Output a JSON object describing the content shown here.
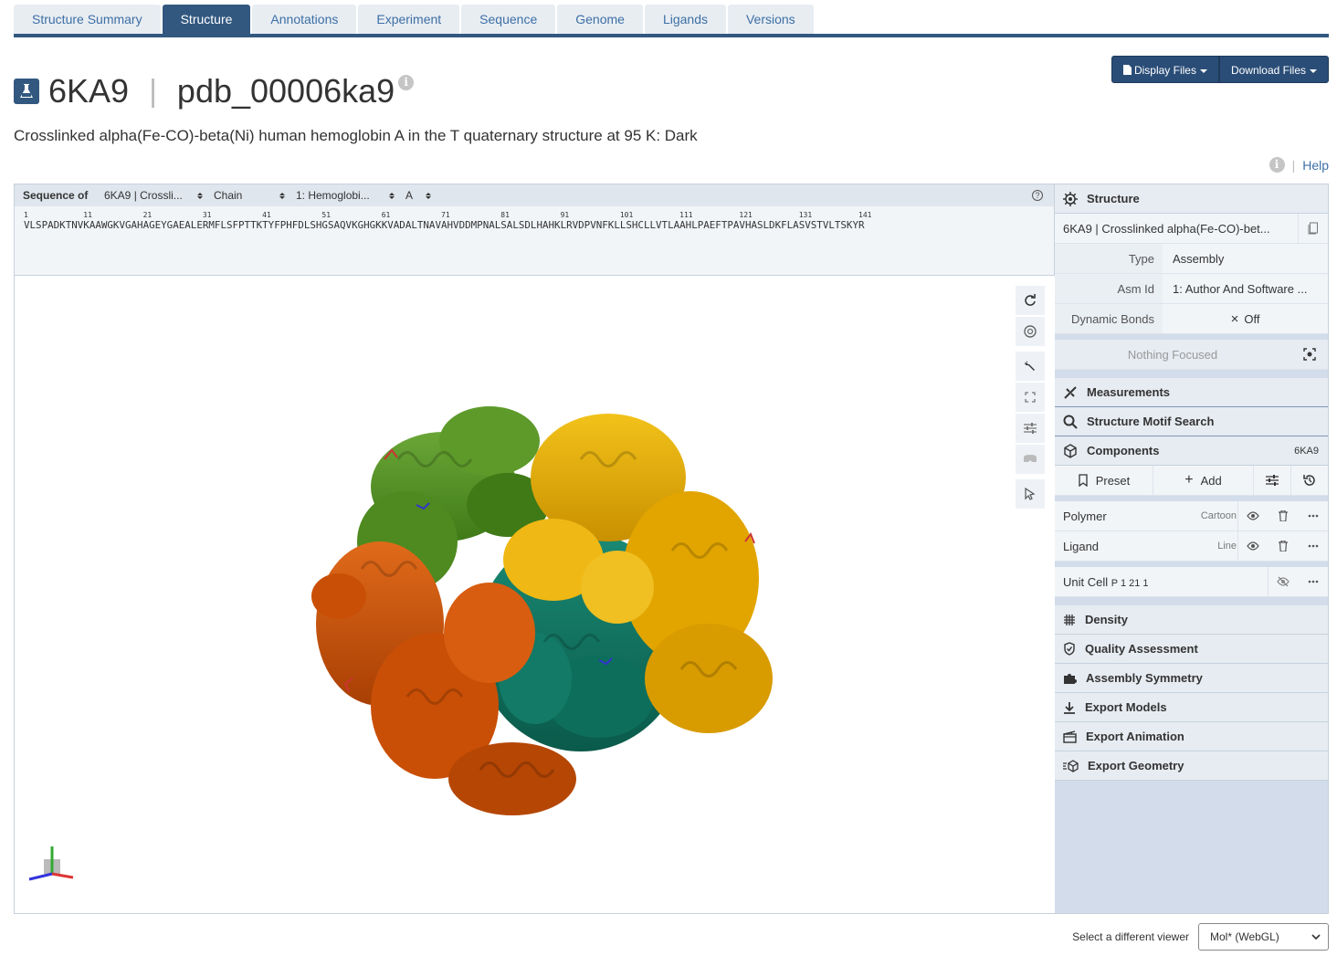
{
  "tabs": [
    {
      "label": "Structure Summary",
      "active": false
    },
    {
      "label": "Structure",
      "active": true
    },
    {
      "label": "Annotations",
      "active": false
    },
    {
      "label": "Experiment",
      "active": false
    },
    {
      "label": "Sequence",
      "active": false
    },
    {
      "label": "Genome",
      "active": false
    },
    {
      "label": "Ligands",
      "active": false
    },
    {
      "label": "Versions",
      "active": false
    }
  ],
  "header": {
    "display_files": "Display Files",
    "download_files": "Download Files",
    "entry_id": "6KA9",
    "separator": "|",
    "pdb_id": "pdb_00006ka9",
    "subtitle": "Crosslinked alpha(Fe-CO)-beta(Ni) human hemoglobin A in the T quaternary structure at 95 K: Dark",
    "help_sep": "|",
    "help": "Help"
  },
  "sequence_panel": {
    "label": "Sequence of",
    "selectors": [
      "6KA9 | Crossli...",
      "Chain",
      "1: Hemoglobi...",
      "A"
    ],
    "numbers": [
      "1",
      "11",
      "21",
      "31",
      "41",
      "51",
      "61",
      "71",
      "81",
      "91",
      "101",
      "111",
      "121",
      "131",
      "141"
    ],
    "sequence": "VLSPADKTNVKAAWGKVGAHAGEYGAEALERMFLSFPTTKTYFPHFDLSHGSAQVKGHGKKVADALTNAVAHVDDMPNALSALSDLHAHKLRVDPVNFKLLSHCLLVTLAAHLPAEFTPAVHASLDKFLASVSTVLTSKYR"
  },
  "right_panel": {
    "structure": {
      "header": "Structure",
      "model": "6KA9 | Crosslinked alpha(Fe-CO)-bet...",
      "rows": [
        {
          "key": "Type",
          "value": "Assembly"
        },
        {
          "key": "Asm Id",
          "value": "1: Author And Software ..."
        }
      ],
      "dynamic_bonds_key": "Dynamic Bonds",
      "dynamic_bonds_value": "Off",
      "focus": "Nothing Focused"
    },
    "measurements": "Measurements",
    "motif_search": "Structure Motif Search",
    "components": {
      "header": "Components",
      "count": "6KA9",
      "preset": "Preset",
      "add": "Add",
      "items": [
        {
          "name": "Polymer",
          "repr": "Cartoon"
        },
        {
          "name": "Ligand",
          "repr": "Line"
        }
      ],
      "unit_cell_name": "Unit Cell",
      "unit_cell_group": "P 1 21 1"
    },
    "sections": [
      {
        "label": "Density",
        "icon": "grid-icon"
      },
      {
        "label": "Quality Assessment",
        "icon": "shield-icon"
      },
      {
        "label": "Assembly Symmetry",
        "icon": "puzzle-icon"
      },
      {
        "label": "Export Models",
        "icon": "download-icon"
      },
      {
        "label": "Export Animation",
        "icon": "film-icon"
      },
      {
        "label": "Export Geometry",
        "icon": "cube-export-icon"
      }
    ]
  },
  "bottom": {
    "label": "Select a different viewer",
    "viewer": "Mol* (WebGL)"
  },
  "colors": {
    "brand": "#325880",
    "chain_a": "#4e8a1f",
    "chain_b": "#e2a500",
    "chain_c": "#c94f06",
    "chain_d": "#0e6e5c"
  }
}
